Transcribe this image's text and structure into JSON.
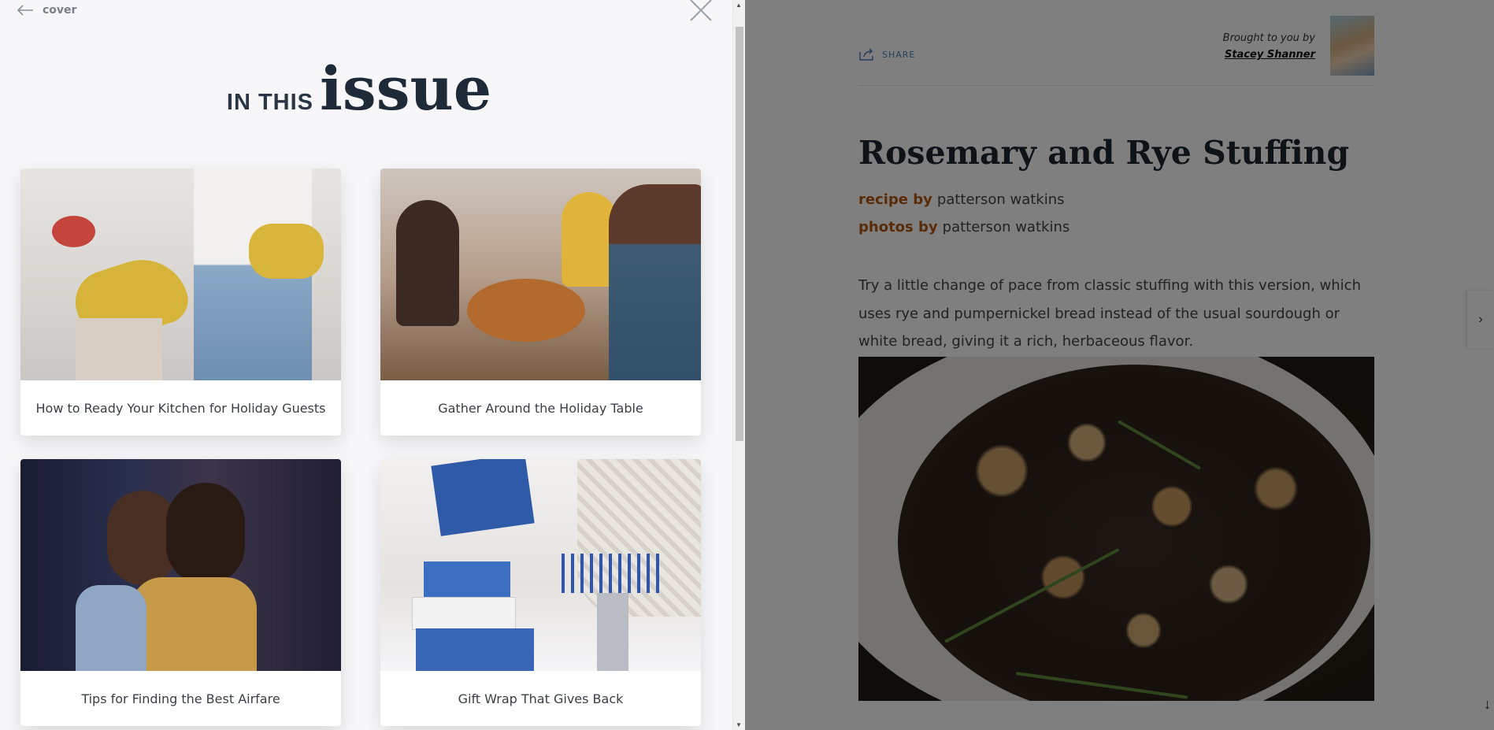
{
  "toc": {
    "back_label": "cover",
    "heading_small": "IN THIS",
    "heading_big": "issue",
    "cards": [
      {
        "caption": "How to Ready Your Kitchen for Holiday Guests"
      },
      {
        "caption": "Gather Around the Holiday Table"
      },
      {
        "caption": "Tips for Finding the Best Airfare"
      },
      {
        "caption": "Gift Wrap That Gives Back"
      }
    ]
  },
  "article": {
    "share_label": "SHARE",
    "brought_by": "Brought to you by",
    "agent_name": "Stacey Shanner",
    "title": "Rosemary and Rye Stuffing",
    "recipe_by_label": "recipe by",
    "recipe_by": "patterson watkins",
    "photos_by_label": "photos by",
    "photos_by": "patterson watkins",
    "description": "Try a little change of pace from classic stuffing with this version, which uses rye and pumpernickel bread instead of the usual sourdough or white bread, giving it a rich, herbaceous flavor.",
    "next_glyph": "›",
    "down_glyph": "↓"
  },
  "colors": {
    "accent": "#b2560f",
    "heading": "#1f2a38",
    "share": "#4f7fb5"
  }
}
